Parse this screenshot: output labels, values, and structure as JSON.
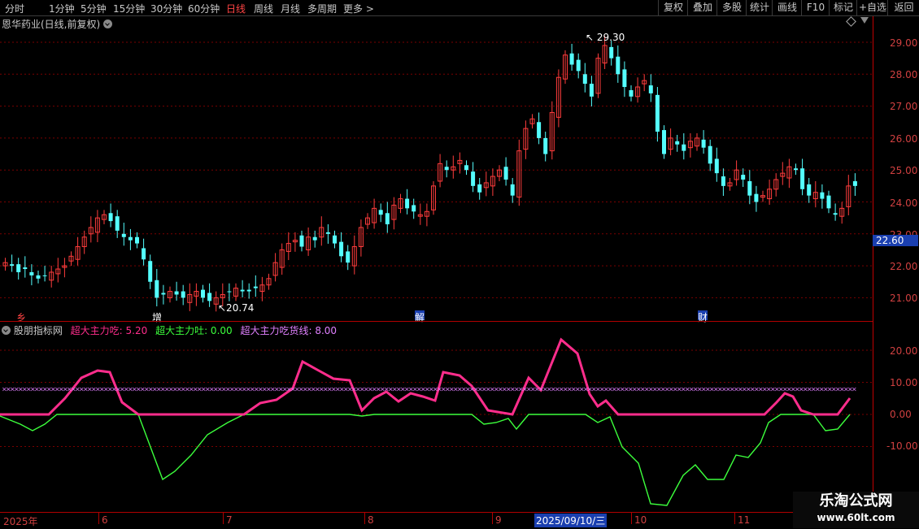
{
  "toolbar": {
    "periods": [
      "分时",
      "1分钟",
      "5分钟",
      "15分钟",
      "30分钟",
      "60分钟",
      "日线",
      "周线",
      "月线",
      "多周期",
      "更多"
    ],
    "active_period": "日线",
    "more_arrow": ">",
    "right_buttons": [
      "复权",
      "叠加",
      "多股",
      "统计",
      "画线",
      "F10",
      "标记",
      "+自选",
      "返回"
    ]
  },
  "stock": {
    "title": "恩华药业(日线,前复权)"
  },
  "price_chart": {
    "y_ticks": [
      "29.00",
      "28.00",
      "27.00",
      "26.00",
      "25.00",
      "24.00",
      "23.00",
      "22.00",
      "21.00"
    ],
    "current_price": "22.60",
    "high_label": "29.30",
    "low_label": "20.74",
    "events": [
      "乡",
      "增",
      "解",
      "财"
    ],
    "up_color": "#ff3c3c",
    "down_color": "#54ffff"
  },
  "indicator": {
    "name": "股朋指标网",
    "lines": [
      {
        "label": "超大主力吃: 5.20",
        "color": "#ff2d8c"
      },
      {
        "label": "超大主力吐: 0.00",
        "color": "#3cff3c"
      },
      {
        "label": "超大主力吃货线: 8.00",
        "color": "#e080ff"
      }
    ],
    "y_ticks": [
      "20.00",
      "10.00",
      "0.00",
      "-10.00"
    ]
  },
  "x_axis": {
    "labels": [
      "2025年",
      "6",
      "7",
      "8",
      "9",
      "10",
      "11"
    ],
    "selected_date": "2025/09/10/三"
  },
  "watermark": {
    "line1": "乐淘公式网",
    "line2": "www.60lt.com"
  }
}
